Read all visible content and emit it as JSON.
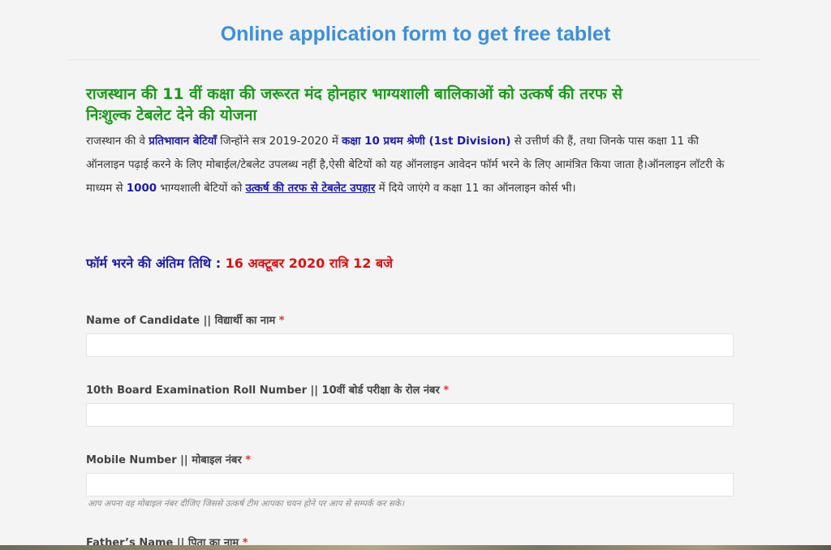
{
  "page": {
    "title": "Online application form to get free tablet",
    "heading_line1": "राजस्थान की 11 वीं कक्षा की जरूरत मंद होनहार भाग्यशाली बालिकाओं को उत्कर्ष की तरफ से",
    "heading_line2": "निःशुल्क टेबलेट देने की योजना"
  },
  "intro": {
    "p1": "राजस्थान की वे ",
    "b1": "प्रतिभावान बेटियाँ",
    "p2": " जिन्होंने सत्र 2019-2020 में ",
    "b2": "कक्षा 10 प्रथम श्रेणी (1st Division)",
    "p3": " से उत्तीर्ण की हैं, तथा जिनके पास कक्षा 11 की ऑनलाइन पढ़ाई करने के लिए मोबाईल/टेबलेट उपलब्ध नहीं है,ऐसी बेटियों को यह ऑनलाइन आवेदन फॉर्म भरने के लिए आमंत्रित किया जाता है।ऑनलाइन लॉटरी के माध्यम से ",
    "b3": "1000",
    "p4": " भाग्यशाली बेटियों को ",
    "b4": "उत्कर्ष की तरफ से टेबलेट उपहार",
    "p5": " में दिये जाएंगे व कक्षा 11 का ऑनलाइन कोर्स भी।"
  },
  "deadline": {
    "label": "फॉर्म भरने की अंतिम तिथि : ",
    "value": "16 अक्टूबर 2020 रात्रि 12 बजे"
  },
  "form": {
    "required_mark": "*",
    "fields": [
      {
        "label": "Name of Candidate || विद्यार्थी का नाम",
        "value": ""
      },
      {
        "label": "10th Board Examination Roll Number || 10वीं बोर्ड परीक्षा के रोल नंबर",
        "value": ""
      },
      {
        "label": "Mobile Number || मोबाइल नंबर",
        "value": "",
        "hint": "आप अपना वह मोबाइल नंबर दीजिए जिससे उत्कर्ष टीम आपका चयन होने पर आप से सम्पर्क कर सके।"
      },
      {
        "label": "Father’s Name || पिता का नाम",
        "value": ""
      }
    ]
  }
}
